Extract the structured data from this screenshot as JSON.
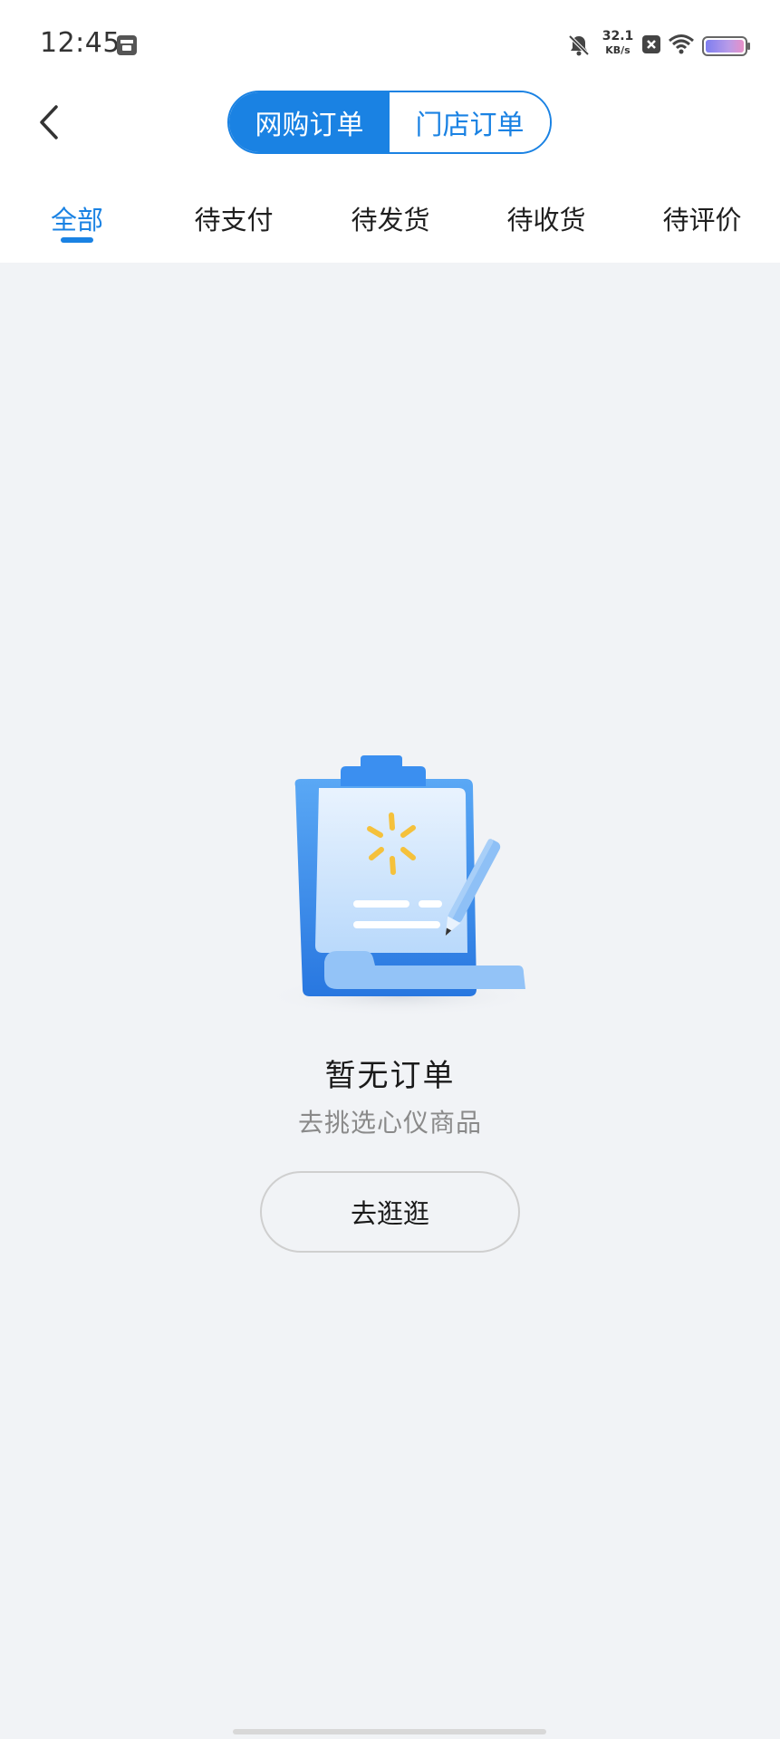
{
  "status_bar": {
    "time": "12:45",
    "net_speed_value": "32.1",
    "net_speed_unit": "KB/s"
  },
  "header": {
    "segments": [
      {
        "label": "网购订单",
        "active": true
      },
      {
        "label": "门店订单",
        "active": false
      }
    ],
    "tabs": [
      {
        "label": "全部",
        "active": true
      },
      {
        "label": "待支付",
        "active": false
      },
      {
        "label": "待发货",
        "active": false
      },
      {
        "label": "待收货",
        "active": false
      },
      {
        "label": "待评价",
        "active": false
      }
    ]
  },
  "empty_state": {
    "title": "暂无订单",
    "subtitle": "去挑选心仪商品",
    "button_label": "去逛逛"
  },
  "colors": {
    "accent": "#1a82e3",
    "background": "#f1f3f6",
    "illustration_spark": "#f5c13b"
  }
}
